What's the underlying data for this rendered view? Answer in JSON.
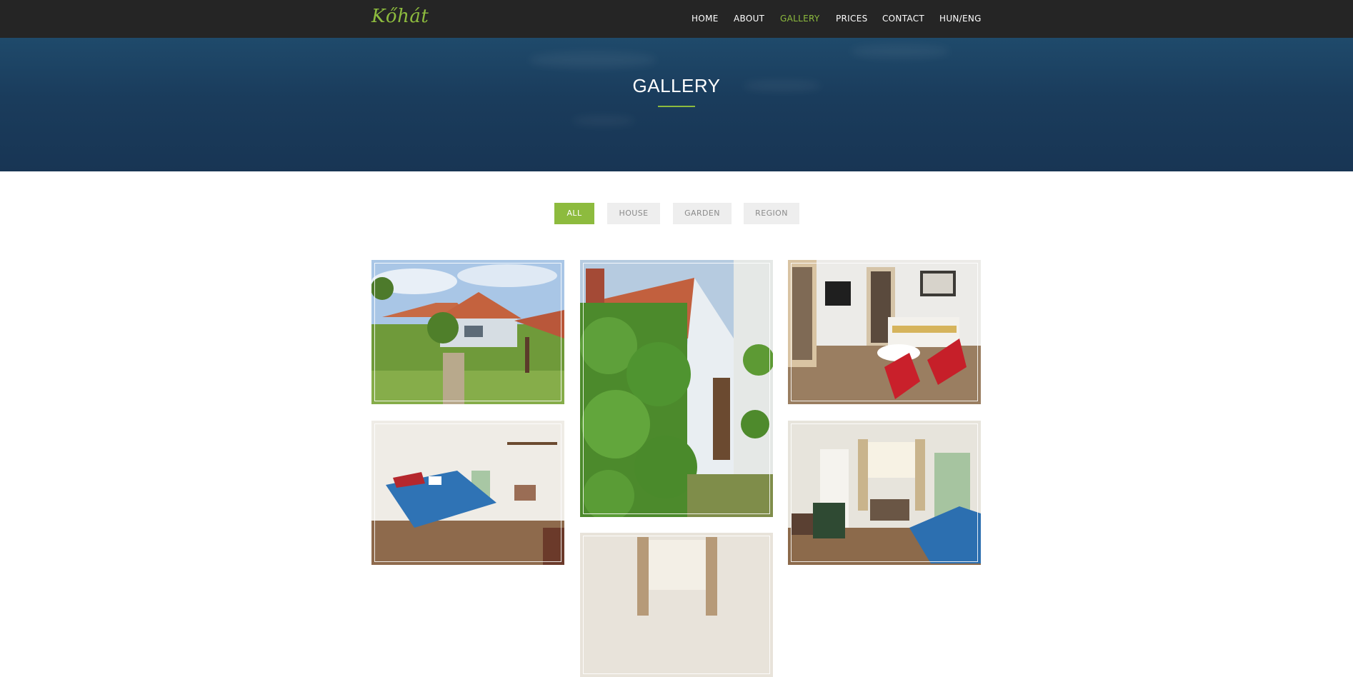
{
  "brand": {
    "logo_text": "Kőhát"
  },
  "nav": {
    "items": [
      {
        "label": "HOME",
        "active": false
      },
      {
        "label": "ABOUT",
        "active": false
      },
      {
        "label": "GALLERY",
        "active": true
      },
      {
        "label": "PRICES",
        "active": false
      },
      {
        "label": "CONTACT",
        "active": false
      },
      {
        "label": "HUN/ENG",
        "active": false
      }
    ]
  },
  "hero": {
    "title": "GALLERY"
  },
  "filters": [
    {
      "label": "ALL",
      "active": true
    },
    {
      "label": "HOUSE",
      "active": false
    },
    {
      "label": "GARDEN",
      "active": false
    },
    {
      "label": "REGION",
      "active": false
    }
  ],
  "gallery": {
    "photos": [
      {
        "subject": "house-with-garden"
      },
      {
        "subject": "house-side-with-hedge"
      },
      {
        "subject": "living-room"
      },
      {
        "subject": "bedroom-blue-bedspread"
      },
      {
        "subject": "bedroom-green-wardrobe"
      },
      {
        "subject": "room-window-curtains"
      }
    ]
  },
  "colors": {
    "accent": "#8dbb3e",
    "nav_background": "#252525",
    "hero_background": "#1a3c5c",
    "filter_inactive": "#eeeeee"
  }
}
